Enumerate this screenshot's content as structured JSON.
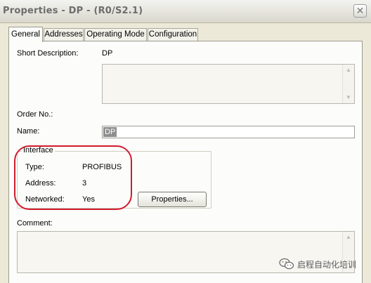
{
  "window": {
    "title": "Properties - DP - (R0/S2.1)",
    "close_glyph": "✕"
  },
  "tabs": [
    {
      "label": "General",
      "active": true
    },
    {
      "label": "Addresses"
    },
    {
      "label": "Operating Mode"
    },
    {
      "label": "Configuration"
    }
  ],
  "general": {
    "short_description_label": "Short Description:",
    "short_description_value": "DP",
    "order_no_label": "Order No.:",
    "name_label": "Name:",
    "name_value": "DP",
    "interface": {
      "legend": "Interface",
      "type_label": "Type:",
      "type_value": "PROFIBUS",
      "address_label": "Address:",
      "address_value": "3",
      "networked_label": "Networked:",
      "networked_value": "Yes",
      "properties_button": "Properties..."
    },
    "comment_label": "Comment:"
  },
  "scroll": {
    "up_glyph": "▲",
    "down_glyph": "▼"
  },
  "watermark": {
    "text": "启程自动化培训",
    "icon": "wechat-icon"
  },
  "colors": {
    "highlight": "#d01c2c",
    "dialog_bg": "#ece9d8"
  }
}
